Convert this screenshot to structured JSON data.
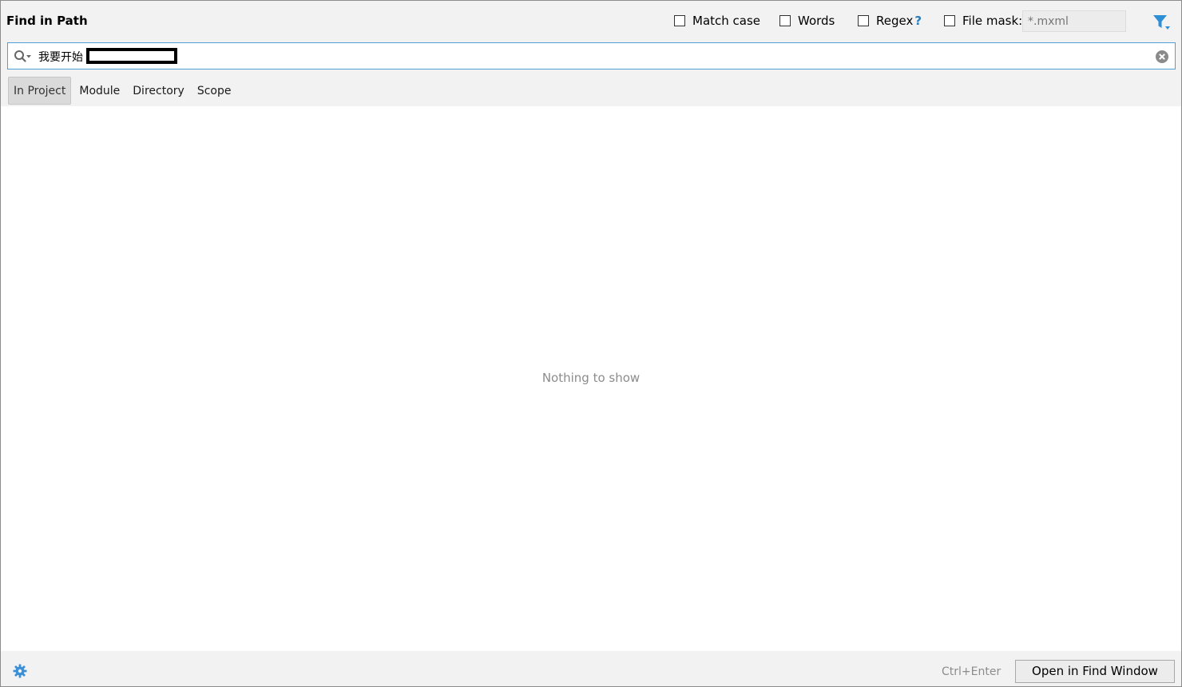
{
  "window": {
    "title": "Find in Path"
  },
  "options": {
    "match_case": {
      "label": "Match case",
      "checked": false
    },
    "words": {
      "label": "Words",
      "checked": false
    },
    "regex": {
      "label": "Regex",
      "help": "?",
      "checked": false
    },
    "file_mask": {
      "label": "File mask:",
      "checked": false,
      "placeholder": "*.mxml"
    }
  },
  "search": {
    "query": "我要开始"
  },
  "scope_tabs": [
    {
      "label": "In Project",
      "selected": true
    },
    {
      "label": "Module",
      "selected": false
    },
    {
      "label": "Directory",
      "selected": false
    },
    {
      "label": "Scope",
      "selected": false
    }
  ],
  "results": {
    "empty_text": "Nothing to show"
  },
  "footer": {
    "shortcut": "Ctrl+Enter",
    "open_button": "Open in Find Window"
  },
  "colors": {
    "accent": "#4f9fd8",
    "filter_icon": "#2d8fd5",
    "gear_icon": "#3a8fd6",
    "help": "#2d7bb8"
  },
  "icons": {
    "filter": "filter-icon",
    "search": "search-icon",
    "clear": "clear-icon",
    "settings": "gear-icon"
  }
}
